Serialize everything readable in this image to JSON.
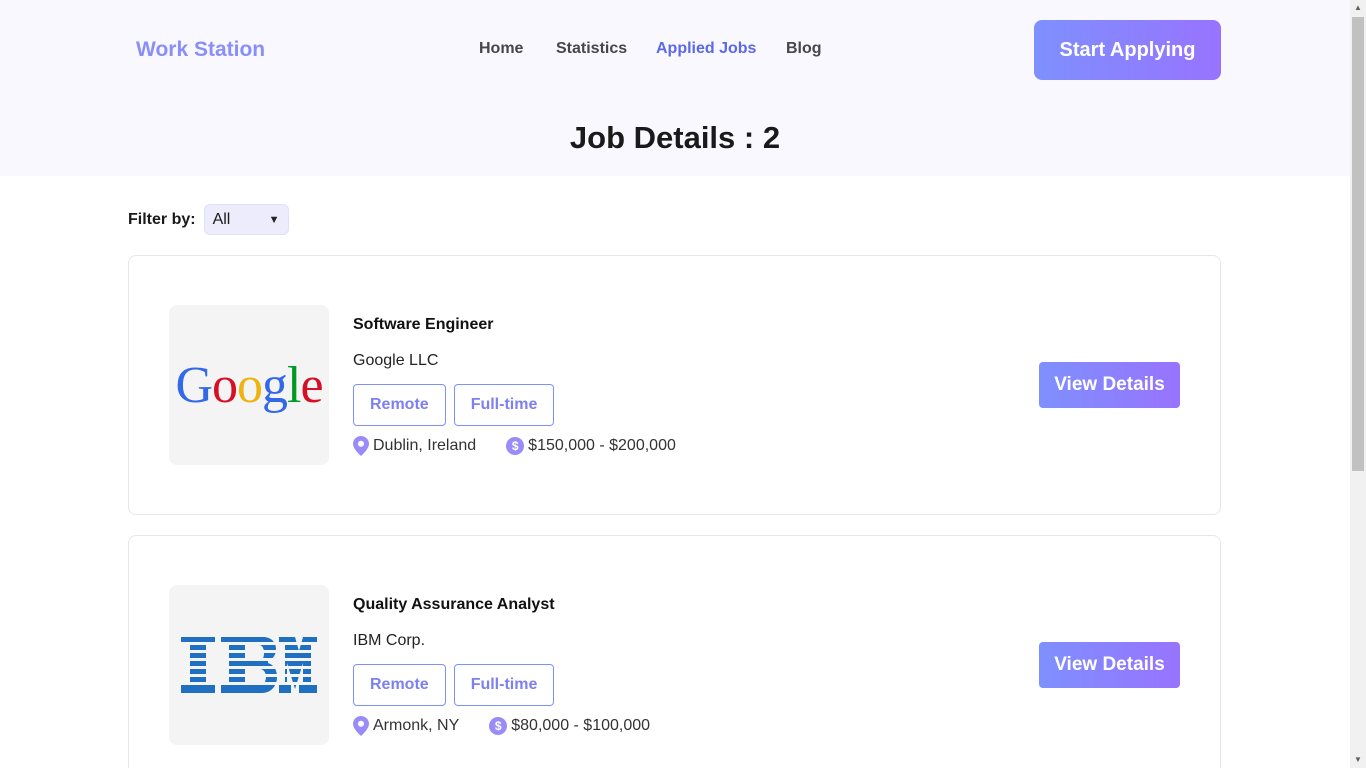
{
  "header": {
    "brand": "Work Station",
    "nav": [
      {
        "label": "Home",
        "active": false
      },
      {
        "label": "Statistics",
        "active": false
      },
      {
        "label": "Applied Jobs",
        "active": true
      },
      {
        "label": "Blog",
        "active": false
      }
    ],
    "cta_label": "Start Applying",
    "page_title": "Job Details : 2"
  },
  "filter": {
    "label": "Filter by:",
    "selected": "All"
  },
  "jobs": [
    {
      "title": "Software Engineer",
      "company": "Google LLC",
      "logo": "Google",
      "tags": [
        "Remote",
        "Full-time"
      ],
      "location": "Dublin, Ireland",
      "salary": "$150,000 - $200,000",
      "button": "View Details"
    },
    {
      "title": "Quality Assurance Analyst",
      "company": "IBM Corp.",
      "logo": "IBM",
      "tags": [
        "Remote",
        "Full-time"
      ],
      "location": "Armonk, NY",
      "salary": "$80,000 - $100,000",
      "button": "View Details"
    }
  ],
  "colors": {
    "accent": "#7e90fe",
    "accent2": "#9873ff",
    "hero_bg": "#f8f8fe",
    "active_nav": "#5b68e8"
  },
  "icons": {
    "location": "map-pin-icon",
    "salary": "dollar-circle-icon"
  }
}
